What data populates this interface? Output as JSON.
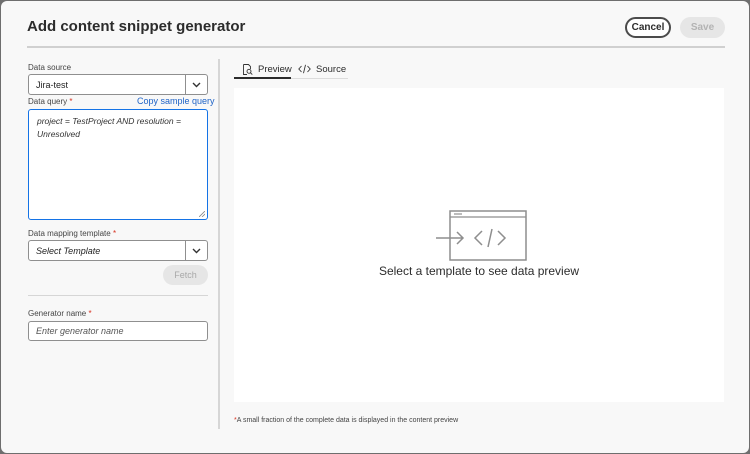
{
  "dialog": {
    "title": "Add content snippet generator",
    "cancel_label": "Cancel",
    "save_label": "Save"
  },
  "form": {
    "data_source_label": "Data source",
    "data_source_value": "Jira-test",
    "data_query_label": "Data query",
    "required_marker": "*",
    "copy_sample_query_label": "Copy sample query",
    "data_query_value": "project = TestProject AND resolution = Unresolved",
    "mapping_template_label": "Data mapping template",
    "mapping_template_placeholder": "Select Template",
    "fetch_label": "Fetch",
    "generator_name_label": "Generator name",
    "generator_name_placeholder": "Enter generator name"
  },
  "tabs": [
    {
      "label": "Preview",
      "icon": "preview-icon",
      "selected": true
    },
    {
      "label": "Source",
      "icon": "code-icon",
      "selected": false
    }
  ],
  "preview": {
    "empty_message": "Select a template to see data preview",
    "footnote_marker": "*",
    "footnote_text": "A small fraction of the complete data is displayed in the content preview"
  },
  "colors": {
    "accent": "#1473e6",
    "link": "#1f63c6",
    "required": "#d73220"
  }
}
